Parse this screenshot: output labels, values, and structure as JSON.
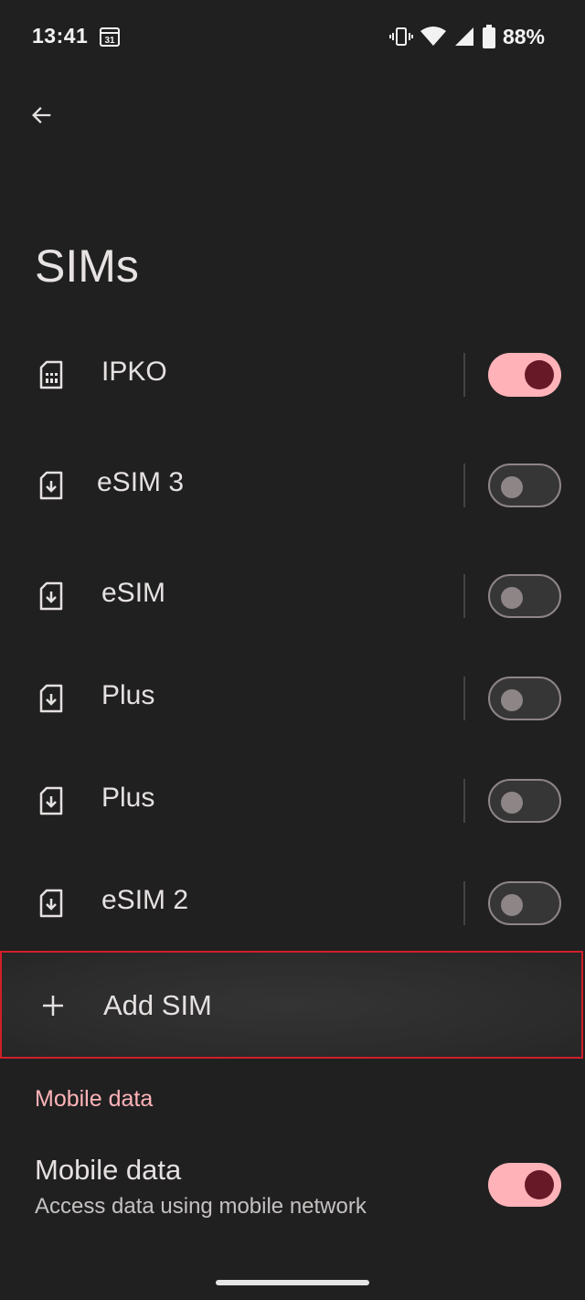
{
  "theme": {
    "background": "#202020",
    "accent": "#ffb3b8",
    "accent_dark": "#681927",
    "highlight_border": "#d01f2a"
  },
  "status_bar": {
    "time": "13:41",
    "calendar_day": "31",
    "battery_percent": "88%",
    "icons": [
      "vibrate-icon",
      "wifi-icon",
      "signal-icon",
      "battery-icon"
    ]
  },
  "header": {
    "back_icon": "arrow-back-icon",
    "title": "SIMs"
  },
  "sims": [
    {
      "label": "IPKO",
      "icon": "sim-card-icon",
      "enabled": true
    },
    {
      "label": "eSIM 3",
      "icon": "esim-download-icon",
      "enabled": false
    },
    {
      "label": "eSIM",
      "icon": "esim-download-icon",
      "enabled": false
    },
    {
      "label": "Plus",
      "icon": "esim-download-icon",
      "enabled": false
    },
    {
      "label": "Plus",
      "icon": "esim-download-icon",
      "enabled": false
    },
    {
      "label": "eSIM 2",
      "icon": "esim-download-icon",
      "enabled": false
    }
  ],
  "add_sim": {
    "label": "Add SIM",
    "icon": "plus-icon"
  },
  "mobile_data_section": {
    "header": "Mobile data",
    "title": "Mobile data",
    "subtitle": "Access data using mobile network",
    "enabled": true
  }
}
